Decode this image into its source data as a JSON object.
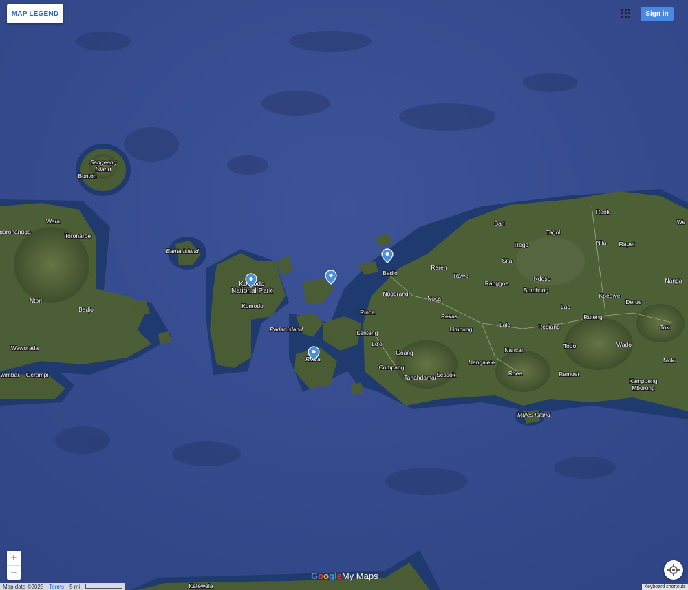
{
  "controls": {
    "legend_button": "MAP LEGEND",
    "sign_in": "Sign in",
    "zoom_in": "+",
    "zoom_out": "−",
    "apps_icon": "apps-grid-icon",
    "locate_icon": "my-location-icon"
  },
  "colors": {
    "sea": "#3a5296",
    "sea_deep": "#2a3d78",
    "shallow": "#1e3766",
    "land": "#4a5c33",
    "land_dark": "#2f3d22",
    "pin": "#4a8fd9",
    "brand_blue": "#1a62d8"
  },
  "map": {
    "type": "satellite",
    "labels": [
      {
        "id": "sangeang-island",
        "text": "Sangeang\nIsland",
        "italic": true
      },
      {
        "id": "bontoh",
        "text": "Bontoh"
      },
      {
        "id": "wara",
        "text": "Wara"
      },
      {
        "id": "garonangga",
        "text": "garonangga"
      },
      {
        "id": "toronaroe",
        "text": "Toronaroe"
      },
      {
        "id": "banta-island",
        "text": "Banta Island",
        "italic": true
      },
      {
        "id": "ntori",
        "text": "Ntori"
      },
      {
        "id": "badjo-west",
        "text": "Badjo"
      },
      {
        "id": "waworada",
        "text": "Waworada"
      },
      {
        "id": "wimbai",
        "text": "wimbai"
      },
      {
        "id": "gerampi",
        "text": "Gerampi"
      },
      {
        "id": "komodo-np",
        "text": "Komodo\nNational Park",
        "big": true
      },
      {
        "id": "komodo",
        "text": "Komodo"
      },
      {
        "id": "padar-island",
        "text": "Padar Island",
        "italic": true
      },
      {
        "id": "rinca-town",
        "text": "Rinca"
      },
      {
        "id": "rinca-island",
        "text": "Rinca",
        "italic": true
      },
      {
        "id": "badjo-east",
        "text": "Badjo"
      },
      {
        "id": "raren",
        "text": "Raren"
      },
      {
        "id": "rawe",
        "text": "Rawe"
      },
      {
        "id": "nggorang",
        "text": "Nggorang"
      },
      {
        "id": "noca",
        "text": "Noca"
      },
      {
        "id": "lenteng",
        "text": "Lenteng"
      },
      {
        "id": "rekas",
        "text": "Rekas"
      },
      {
        "id": "limbung",
        "text": "Limbung"
      },
      {
        "id": "loo",
        "text": "Lo'o"
      },
      {
        "id": "goang",
        "text": "Goang"
      },
      {
        "id": "compang",
        "text": "Compang"
      },
      {
        "id": "tanahdamar",
        "text": "Tanahdamar"
      },
      {
        "id": "sessok",
        "text": "Sessok"
      },
      {
        "id": "nangalele",
        "text": "Nangalele"
      },
      {
        "id": "bari",
        "text": "Bari"
      },
      {
        "id": "rego",
        "text": "Rego"
      },
      {
        "id": "tagol",
        "text": "Tagol"
      },
      {
        "id": "sita",
        "text": "Sita"
      },
      {
        "id": "ranggoe",
        "text": "Ranggoe"
      },
      {
        "id": "ndoso",
        "text": "Ndoso"
      },
      {
        "id": "bombong",
        "text": "Bombong"
      },
      {
        "id": "reok",
        "text": "Reok"
      },
      {
        "id": "nila",
        "text": "Nila"
      },
      {
        "id": "rapet",
        "text": "Rapet"
      },
      {
        "id": "nanga",
        "text": "Nanga"
      },
      {
        "id": "lao",
        "text": "Lao"
      },
      {
        "id": "koeowe",
        "text": "Koeowe"
      },
      {
        "id": "deroe",
        "text": "Deroe"
      },
      {
        "id": "lale",
        "text": "Lale"
      },
      {
        "id": "redjang",
        "text": "Redjang"
      },
      {
        "id": "ruteng",
        "text": "Ruteng"
      },
      {
        "id": "tok",
        "text": "Tok"
      },
      {
        "id": "todo",
        "text": "Todo"
      },
      {
        "id": "wado",
        "text": "Wado"
      },
      {
        "id": "nancar",
        "text": "Nancar"
      },
      {
        "id": "roea",
        "text": "Roea"
      },
      {
        "id": "ramoet",
        "text": "Ramoet"
      },
      {
        "id": "mok",
        "text": "Mok"
      },
      {
        "id": "kampoeng-mborong",
        "text": "Kampoeng\nMborong"
      },
      {
        "id": "mules-island",
        "text": "Mules Island",
        "italic": true
      },
      {
        "id": "we",
        "text": "We"
      },
      {
        "id": "katewel",
        "text": "Katewela"
      }
    ],
    "pins": [
      {
        "id": "pin-komodo"
      },
      {
        "id": "pin-padar-north"
      },
      {
        "id": "pin-labuan-bajo"
      },
      {
        "id": "pin-rinca"
      }
    ]
  },
  "footer": {
    "brand": {
      "g": "G",
      "o1": "o",
      "o2": "o",
      "g2": "g",
      "l": "l",
      "e": "e",
      "mymaps": "My Maps"
    },
    "map_data": "Map data ©2025",
    "terms": "Terms",
    "scale": "5 mi",
    "keyboard": "Keyboard shortcuts"
  }
}
